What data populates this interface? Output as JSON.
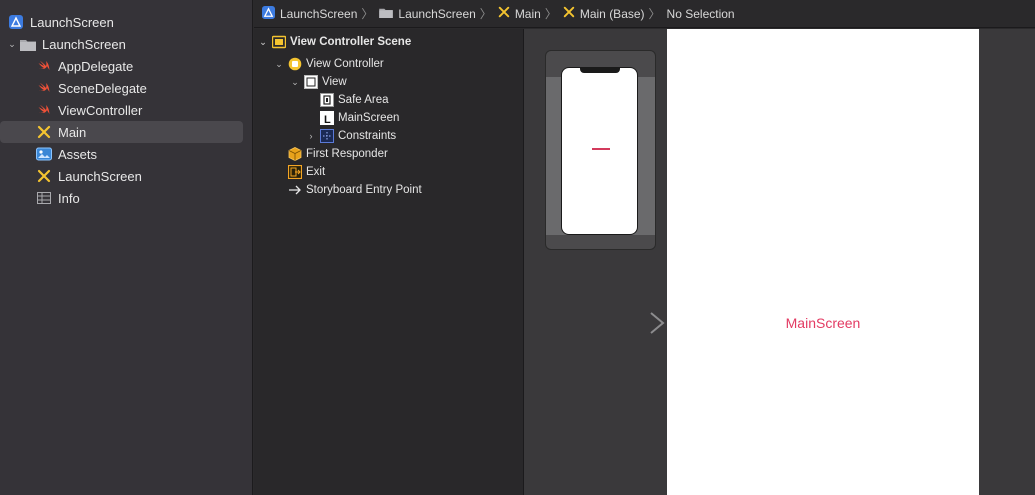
{
  "navigator": {
    "project": "LaunchScreen",
    "group": "LaunchScreen",
    "files": [
      {
        "name": "AppDelegate",
        "icon": "swift-icon"
      },
      {
        "name": "SceneDelegate",
        "icon": "swift-icon"
      },
      {
        "name": "ViewController",
        "icon": "swift-icon"
      },
      {
        "name": "Main",
        "icon": "storyboard-icon"
      },
      {
        "name": "Assets",
        "icon": "asset-catalog-icon"
      },
      {
        "name": "LaunchScreen",
        "icon": "storyboard-icon"
      },
      {
        "name": "Info",
        "icon": "plist-icon"
      }
    ]
  },
  "jumpbar": {
    "crumbs": [
      "LaunchScreen",
      "LaunchScreen",
      "Main",
      "Main (Base)",
      "No Selection"
    ]
  },
  "outline": {
    "scene": "View Controller Scene",
    "view_controller": "View Controller",
    "view": "View",
    "safe_area": "Safe Area",
    "label": "MainScreen",
    "constraints": "Constraints",
    "first_responder": "First Responder",
    "exit": "Exit",
    "entry_point": "Storyboard Entry Point"
  },
  "canvas": {
    "label_text": "MainScreen",
    "label_color": "#e33b63"
  },
  "colors": {
    "swift": "#f05138",
    "storyboard": "#f4c430",
    "project_blue": "#3c7be0"
  }
}
